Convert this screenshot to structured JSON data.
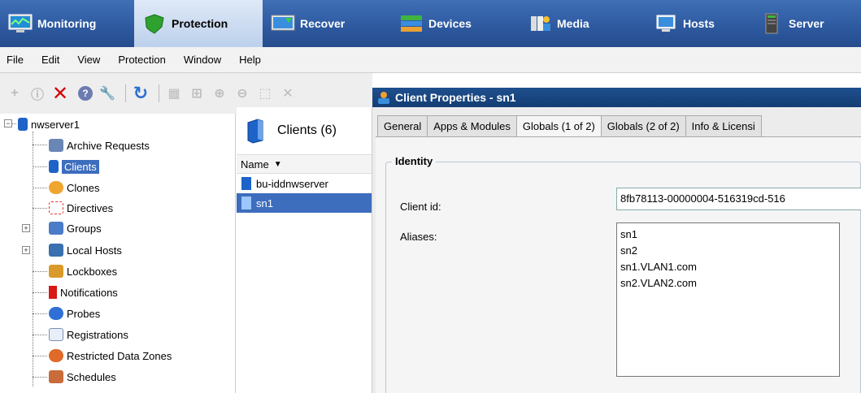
{
  "nav": {
    "tabs": [
      {
        "label": "Monitoring",
        "icon": "monitor-icon"
      },
      {
        "label": "Protection",
        "icon": "shield-icon"
      },
      {
        "label": "Recover",
        "icon": "recover-icon"
      },
      {
        "label": "Devices",
        "icon": "devices-icon"
      },
      {
        "label": "Media",
        "icon": "media-icon"
      },
      {
        "label": "Hosts",
        "icon": "hosts-icon"
      },
      {
        "label": "Server",
        "icon": "server-icon"
      }
    ],
    "active": "Protection"
  },
  "menu": [
    "File",
    "Edit",
    "View",
    "Protection",
    "Window",
    "Help"
  ],
  "tree": {
    "root": "nwserver1",
    "items": [
      "Archive Requests",
      "Clients",
      "Clones",
      "Directives",
      "Groups",
      "Local Hosts",
      "Lockboxes",
      "Notifications",
      "Probes",
      "Registrations",
      "Restricted Data Zones",
      "Schedules"
    ],
    "selected": "Clients"
  },
  "clients_panel": {
    "title": "Clients (6)",
    "column": "Name",
    "items": [
      "bu-iddnwserver",
      "sn1"
    ],
    "selected": "sn1"
  },
  "properties": {
    "title": "Client Properties - sn1",
    "tabs": [
      "General",
      "Apps & Modules",
      "Globals (1 of 2)",
      "Globals (2 of 2)",
      "Info & Licensi"
    ],
    "active_tab": "Globals (1 of 2)",
    "group_title": "Identity",
    "client_id_label": "Client id:",
    "client_id_value": "8fb78113-00000004-516319cd-516",
    "aliases_label": "Aliases:",
    "aliases": [
      "sn1",
      "sn2",
      "sn1.VLAN1.com",
      "sn2.VLAN2.com"
    ]
  }
}
